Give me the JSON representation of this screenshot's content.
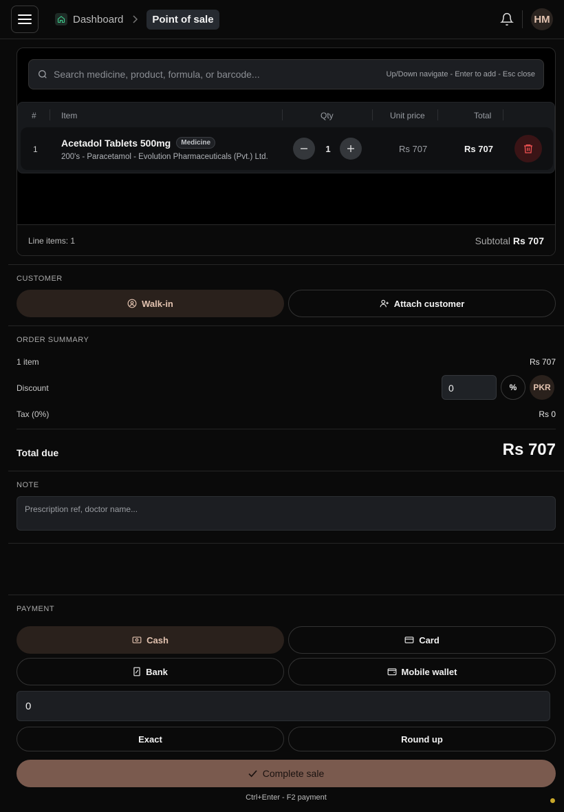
{
  "header": {
    "breadcrumb_home": "Dashboard",
    "breadcrumb_current": "Point of sale",
    "avatar_initials": "HM",
    "icons": [
      "menu-icon",
      "home-icon",
      "chevron-right-icon",
      "bell-icon"
    ]
  },
  "cart": {
    "search_placeholder": "Search medicine, product, formula, or barcode...",
    "search_hint": "Up/Down navigate - Enter to add - Esc close",
    "columns": [
      "#",
      "Item",
      "Qty",
      "Unit price",
      "Total"
    ],
    "rows": [
      {
        "num": "1",
        "name": "Acetadol Tablets 500mg",
        "badge": "Medicine",
        "subtitle": "200's - Paracetamol - Evolution Pharmaceuticals (Pvt.) Ltd.",
        "qty": "1",
        "unit_price": "Rs 707",
        "total": "Rs 707"
      }
    ],
    "line_items": "Line items: 1",
    "subtotal_label": "Subtotal",
    "subtotal_value": "Rs 707"
  },
  "customer": {
    "label": "CUSTOMER",
    "walk_in": "Walk-in",
    "attach": "Attach customer"
  },
  "summary": {
    "label": "ORDER SUMMARY",
    "items_label": "1 item",
    "items_value": "Rs 707",
    "discount_label": "Discount",
    "discount_value": "0",
    "percent": "%",
    "currency": "PKR",
    "tax_label": "Tax (0%)",
    "tax_value": "Rs 0",
    "total_label": "Total due",
    "total_value": "Rs 707"
  },
  "note": {
    "label": "NOTE",
    "placeholder": "Prescription ref, doctor name..."
  },
  "payment": {
    "label": "PAYMENT",
    "methods": [
      "Cash",
      "Card",
      "Bank",
      "Mobile wallet"
    ],
    "amount": "0",
    "exact": "Exact",
    "round_up": "Round up",
    "complete": "Complete sale",
    "shortcut_hint": "Ctrl+Enter - F2 payment"
  },
  "colors": {
    "background": "#0a0a0a",
    "accent": "#7a5a4e",
    "selected_pill": "#2a211c",
    "danger": "#3a1416",
    "status_dot": "#c8a72a"
  }
}
